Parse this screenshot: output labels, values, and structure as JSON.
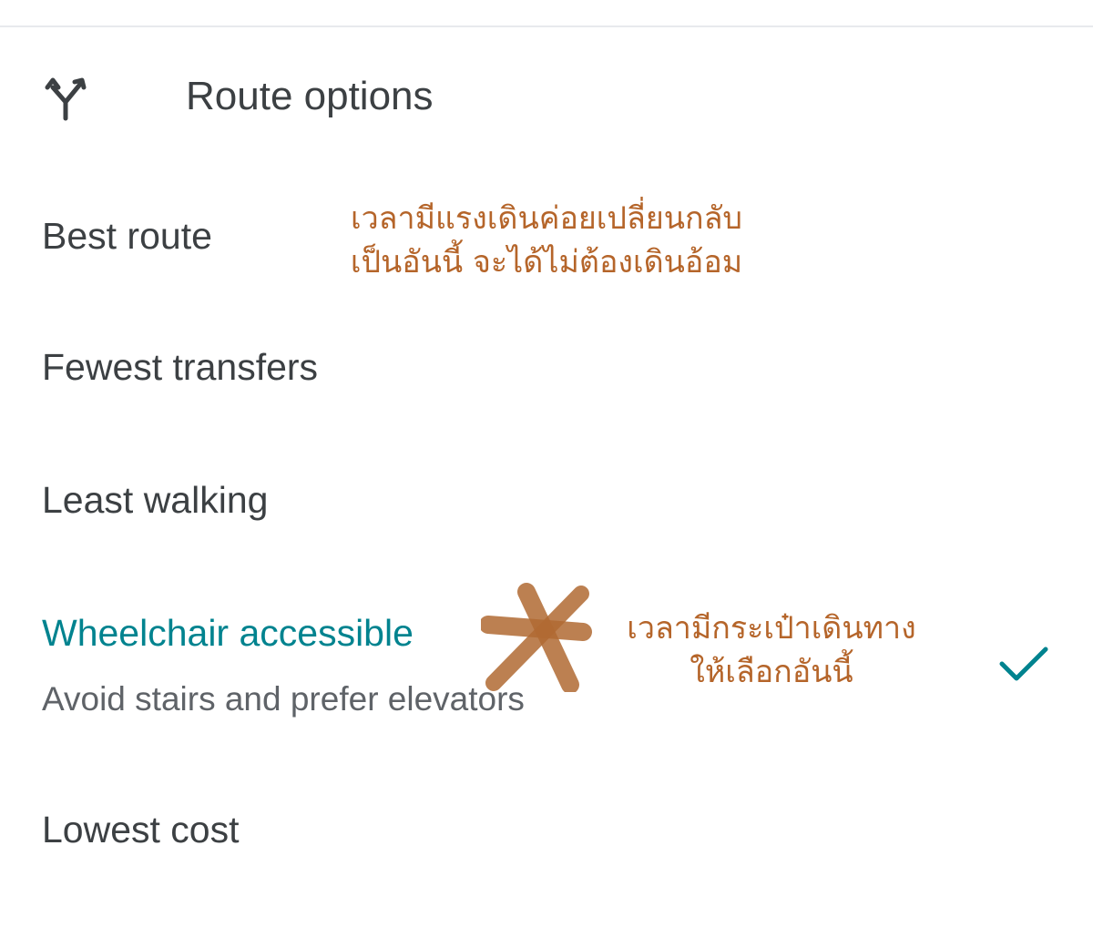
{
  "header": {
    "title": "Route options",
    "icon": "route-fork-icon"
  },
  "options": [
    {
      "label": "Best route",
      "sublabel": "",
      "selected": false
    },
    {
      "label": "Fewest transfers",
      "sublabel": "",
      "selected": false
    },
    {
      "label": "Least walking",
      "sublabel": "",
      "selected": false
    },
    {
      "label": "Wheelchair accessible",
      "sublabel": "Avoid stairs and prefer elevators",
      "selected": true
    },
    {
      "label": "Lowest cost",
      "sublabel": "",
      "selected": false
    }
  ],
  "annotations": {
    "best_route_note": {
      "line1": "เวลามีแรงเดินค่อยเปลี่ยนกลับ",
      "line2": "เป็นอันนี้ จะได้ไม่ต้องเดินอ้อม"
    },
    "wheelchair_note": {
      "line1": "เวลามีกระเป๋าเดินทาง",
      "line2": "ให้เลือกอันนี้"
    }
  },
  "colors": {
    "selected_accent": "#00838f",
    "text_primary": "#3c4043",
    "text_secondary": "#5f6368",
    "annotation": "#b5652a",
    "annotation_mark": "#b06a33"
  }
}
